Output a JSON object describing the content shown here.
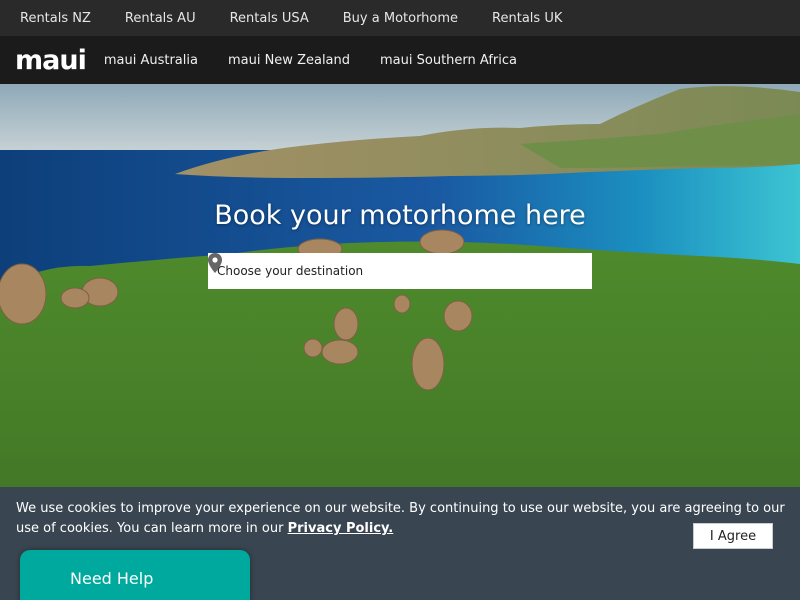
{
  "topnav": {
    "items": [
      "Rentals NZ",
      "Rentals AU",
      "Rentals USA",
      "Buy a Motorhome",
      "Rentals UK"
    ]
  },
  "brand": {
    "logo": "maui",
    "nav": [
      "maui Australia",
      "maui New Zealand",
      "maui Southern Africa"
    ]
  },
  "hero": {
    "title": "Book your motorhome here",
    "destination_placeholder": "Choose your destination",
    "pin_icon": "map-pin-icon"
  },
  "cookie": {
    "text": "We use cookies to improve your experience on our website. By continuing to use our website, you are agreeing to our use of cookies. You can learn more in our ",
    "link": "Privacy Policy.",
    "agree_label": "I Agree"
  },
  "help": {
    "label": "Need Help"
  },
  "colors": {
    "topbar_bg": "#2a2a2a",
    "brandbar_bg": "#1b1b1b",
    "cookie_bg": "#394651",
    "help_bg": "#00a99d"
  }
}
